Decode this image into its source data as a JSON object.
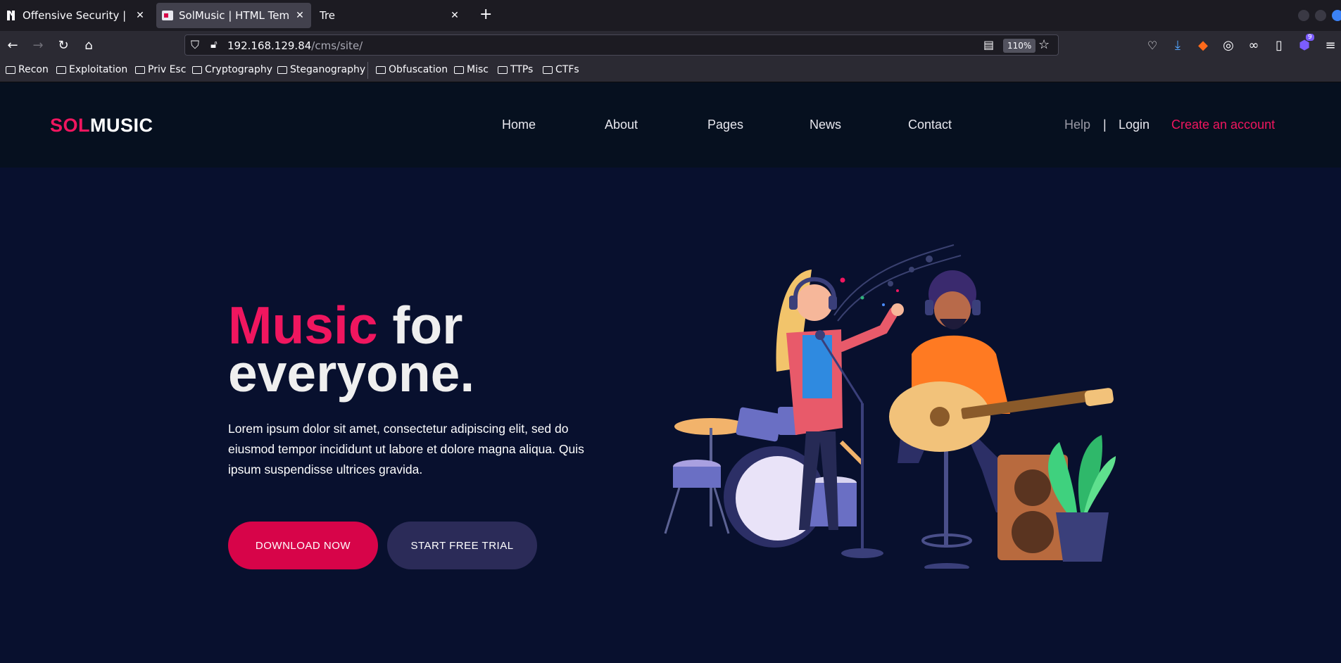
{
  "browser": {
    "tabs": [
      {
        "title": "Offensive Security | Labs |",
        "active": false
      },
      {
        "title": "SolMusic | HTML Template",
        "active": true
      },
      {
        "title": "Tre",
        "active": false
      }
    ],
    "url_host": "192.168.129.84",
    "url_path": "/cms/site/",
    "zoom": "110%",
    "extension_badge": "9",
    "bookmarks": [
      "Recon",
      "Exploitation",
      "Priv Esc",
      "Cryptography",
      "Steganography",
      "Obfuscation",
      "Misc",
      "TTPs",
      "CTFs"
    ]
  },
  "site": {
    "logo_part1": "SOL",
    "logo_part2": "MUSIC",
    "nav": [
      "Home",
      "About",
      "Pages",
      "News",
      "Contact"
    ],
    "help": "Help",
    "divider": "|",
    "login": "Login",
    "create_account": "Create an account",
    "headline_pink": "Music",
    "headline_rest_line1": " for",
    "headline_line2": "everyone.",
    "lede": "Lorem ipsum dolor sit amet, consectetur adipiscing elit, sed do eiusmod tempor incididunt ut labore et dolore magna aliqua. Quis ipsum suspendisse ultrices gravida.",
    "download_button": "DOWNLOAD NOW",
    "trial_button": "START FREE TRIAL"
  },
  "colors": {
    "accent_pink": "#f0165f",
    "button_pink": "#d70449",
    "button_indigo": "#2b2b58",
    "hero_bg": "#08102e",
    "header_bg": "#06101f"
  }
}
